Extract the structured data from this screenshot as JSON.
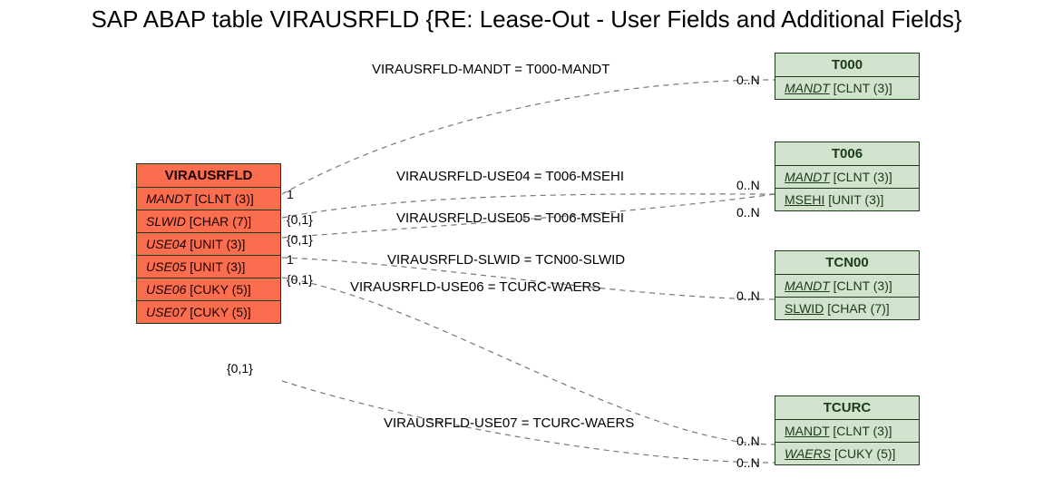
{
  "title": "SAP ABAP table VIRAUSRFLD {RE: Lease-Out - User Fields and Additional Fields}",
  "source": {
    "name": "VIRAUSRFLD",
    "fields": [
      {
        "label": "MANDT",
        "type": "[CLNT (3)]"
      },
      {
        "label": "SLWID",
        "type": "[CHAR (7)]"
      },
      {
        "label": "USE04",
        "type": "[UNIT (3)]"
      },
      {
        "label": "USE05",
        "type": "[UNIT (3)]"
      },
      {
        "label": "USE06",
        "type": "[CUKY (5)]"
      },
      {
        "label": "USE07",
        "type": "[CUKY (5)]"
      }
    ]
  },
  "targets": {
    "t000": {
      "name": "T000",
      "fields": [
        {
          "label": "MANDT",
          "type": "[CLNT (3)]",
          "fk": true
        }
      ]
    },
    "t006": {
      "name": "T006",
      "fields": [
        {
          "label": "MANDT",
          "type": "[CLNT (3)]",
          "fk": true
        },
        {
          "label": "MSEHI",
          "type": "[UNIT (3)]",
          "fk": false
        }
      ]
    },
    "tcn00": {
      "name": "TCN00",
      "fields": [
        {
          "label": "MANDT",
          "type": "[CLNT (3)]",
          "fk": true
        },
        {
          "label": "SLWID",
          "type": "[CHAR (7)]",
          "fk": false
        }
      ]
    },
    "tcurc": {
      "name": "TCURC",
      "fields": [
        {
          "label": "MANDT",
          "type": "[CLNT (3)]",
          "fk": false
        },
        {
          "label": "WAERS",
          "type": "[CUKY (5)]",
          "fk": true
        }
      ]
    }
  },
  "relations": {
    "r1": "VIRAUSRFLD-MANDT = T000-MANDT",
    "r2": "VIRAUSRFLD-USE04 = T006-MSEHI",
    "r3": "VIRAUSRFLD-USE05 = T006-MSEHI",
    "r4": "VIRAUSRFLD-SLWID = TCN00-SLWID",
    "r5": "VIRAUSRFLD-USE06 = TCURC-WAERS",
    "r6": "VIRAUSRFLD-USE07 = TCURC-WAERS"
  },
  "card": {
    "one": "1",
    "zo": "{0,1}",
    "zn": "0..N"
  }
}
